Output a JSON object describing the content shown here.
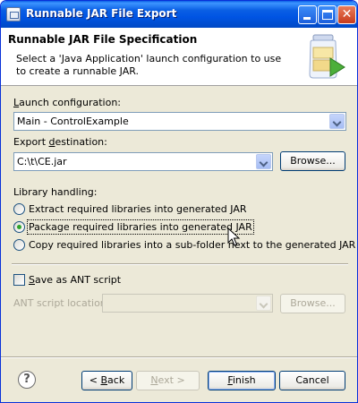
{
  "window": {
    "title": "Runnable JAR File Export",
    "close_glyph": "✕"
  },
  "banner": {
    "title": "Runnable JAR File Specification",
    "description": "Select a 'Java Application' launch configuration to use to create a runnable JAR.",
    "icon": "jar-wizard-icon"
  },
  "launch": {
    "label_prefix": "",
    "label_mnemonic": "L",
    "label_rest": "aunch configuration:",
    "value": "Main - ControlExample"
  },
  "export": {
    "label_prefix": "Export ",
    "label_mnemonic": "d",
    "label_rest": "estination:",
    "value": "C:\\t\\CE.jar",
    "browse": "Browse..."
  },
  "library": {
    "label": "Library handling:",
    "options": [
      {
        "text": "Extract required libraries into generated JAR",
        "checked": false
      },
      {
        "text": "Package required libraries into generated JAR",
        "checked": true
      },
      {
        "text": "Copy required libraries into a sub-folder next to the generated JAR",
        "checked": false
      }
    ]
  },
  "ant": {
    "checkbox_prefix": "",
    "checkbox_mnemonic": "S",
    "checkbox_rest": "ave as ANT script",
    "checked": false,
    "location_label": "ANT script location:",
    "location_value": "",
    "browse": "Browse..."
  },
  "footer": {
    "help": "?",
    "back_prefix": "< ",
    "back_mnemonic": "B",
    "back_rest": "ack",
    "next_prefix": "",
    "next_mnemonic": "N",
    "next_rest": "ext >",
    "finish_prefix": "",
    "finish_mnemonic": "F",
    "finish_rest": "inish",
    "cancel": "Cancel"
  },
  "colors": {
    "titlebar": "#0054e3",
    "face": "#ece9d8",
    "radio_dot": "#2fa42c"
  }
}
